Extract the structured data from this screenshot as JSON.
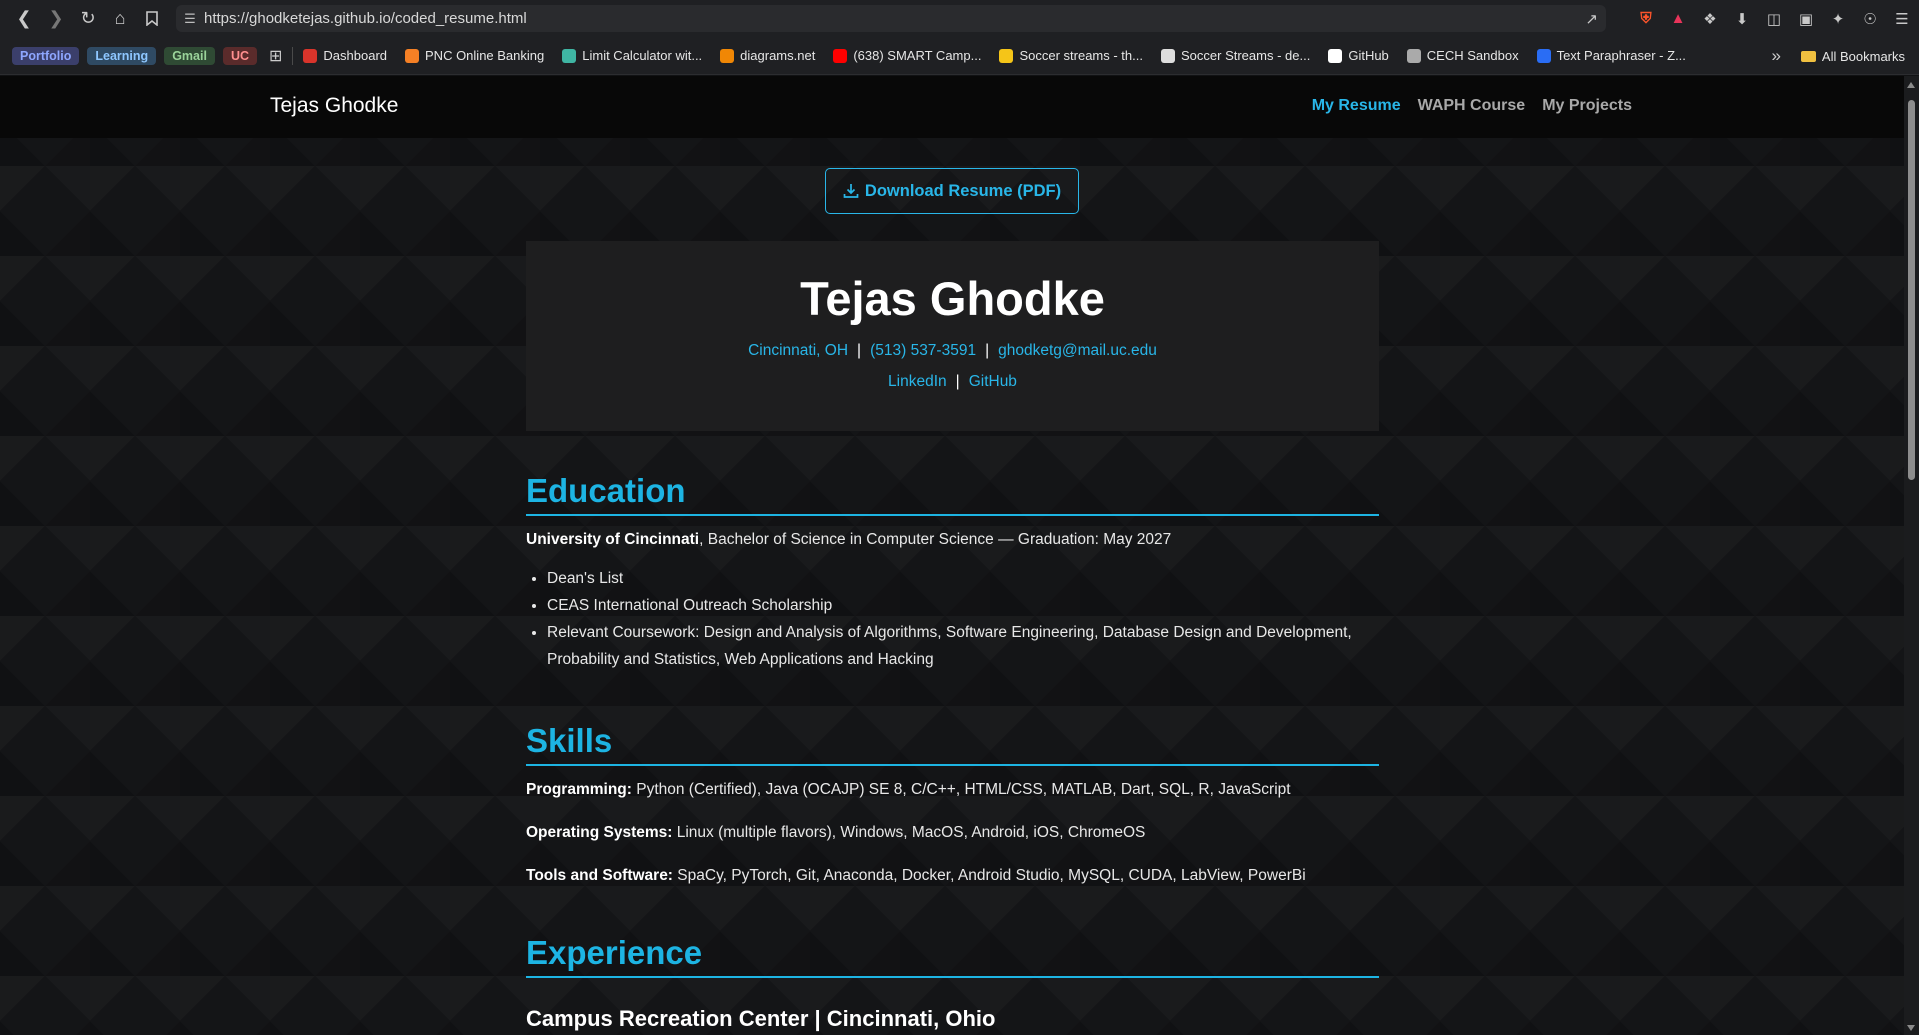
{
  "browser": {
    "url": "https://ghodketejas.github.io/coded_resume.html",
    "bookmark_groups": [
      {
        "label": "Portfolio",
        "color": "#8ea7ff",
        "bg": "#3b3f6b"
      },
      {
        "label": "Learning",
        "color": "#8ec7ff",
        "bg": "#2f4a63"
      },
      {
        "label": "Gmail",
        "color": "#9ad39a",
        "bg": "#2f4a34"
      },
      {
        "label": "UC",
        "color": "#ff8f8f",
        "bg": "#5a2b2b"
      }
    ],
    "bookmarks": [
      {
        "label": "Dashboard",
        "icon": "canvas-icon",
        "color": "#d9342b"
      },
      {
        "label": "PNC Online Banking",
        "icon": "pnc-icon",
        "color": "#f58025"
      },
      {
        "label": "Limit Calculator wit...",
        "icon": "cube-icon",
        "color": "#3fb5a3"
      },
      {
        "label": "diagrams.net",
        "icon": "diagrams-icon",
        "color": "#f08705"
      },
      {
        "label": "(638) SMART Camp...",
        "icon": "youtube-icon",
        "color": "#ff0000"
      },
      {
        "label": "Soccer streams - th...",
        "icon": "check-icon",
        "color": "#f5c518"
      },
      {
        "label": "Soccer Streams - de...",
        "icon": "ball-icon",
        "color": "#dddddd"
      },
      {
        "label": "GitHub",
        "icon": "github-icon",
        "color": "#ffffff"
      },
      {
        "label": "CECH Sandbox",
        "icon": "globe-icon",
        "color": "#aaaaaa"
      },
      {
        "label": "Text Paraphraser - Z...",
        "icon": "paraphraser-icon",
        "color": "#2a6df4"
      }
    ],
    "more_label": "»",
    "all_bookmarks_label": "All Bookmarks",
    "brave_badge": "1"
  },
  "site": {
    "brand": "Tejas Ghodke",
    "nav": [
      {
        "label": "My Resume",
        "active": true
      },
      {
        "label": "WAPH Course",
        "active": false
      },
      {
        "label": "My Projects",
        "active": false
      }
    ],
    "download_label": "Download Resume (PDF)"
  },
  "header": {
    "name": "Tejas Ghodke",
    "location": "Cincinnati, OH",
    "phone": "(513) 537-3591",
    "email": "ghodketg@mail.uc.edu",
    "linkedin": "LinkedIn",
    "github": "GitHub",
    "separator": "|"
  },
  "education": {
    "heading": "Education",
    "school": "University of Cincinnati",
    "detail": ", Bachelor of Science in Computer Science — Graduation: May 2027",
    "bullets": [
      "Dean's List",
      "CEAS International Outreach Scholarship",
      "Relevant Coursework: Design and Analysis of Algorithms, Software Engineering, Database Design and Development, Probability and Statistics, Web Applications and Hacking"
    ]
  },
  "skills": {
    "heading": "Skills",
    "rows": [
      {
        "label": "Programming:",
        "value": " Python (Certified), Java (OCAJP) SE 8, C/C++, HTML/CSS, MATLAB, Dart, SQL, R, JavaScript"
      },
      {
        "label": "Operating Systems:",
        "value": " Linux (multiple flavors), Windows, MacOS, Android, iOS, ChromeOS"
      },
      {
        "label": "Tools and Software:",
        "value": " SpaCy, PyTorch, Git, Anaconda, Docker, Android Studio, MySQL, CUDA, LabView, PowerBi"
      }
    ]
  },
  "experience": {
    "heading": "Experience",
    "first_title": "Campus Recreation Center | Cincinnati, Ohio"
  }
}
